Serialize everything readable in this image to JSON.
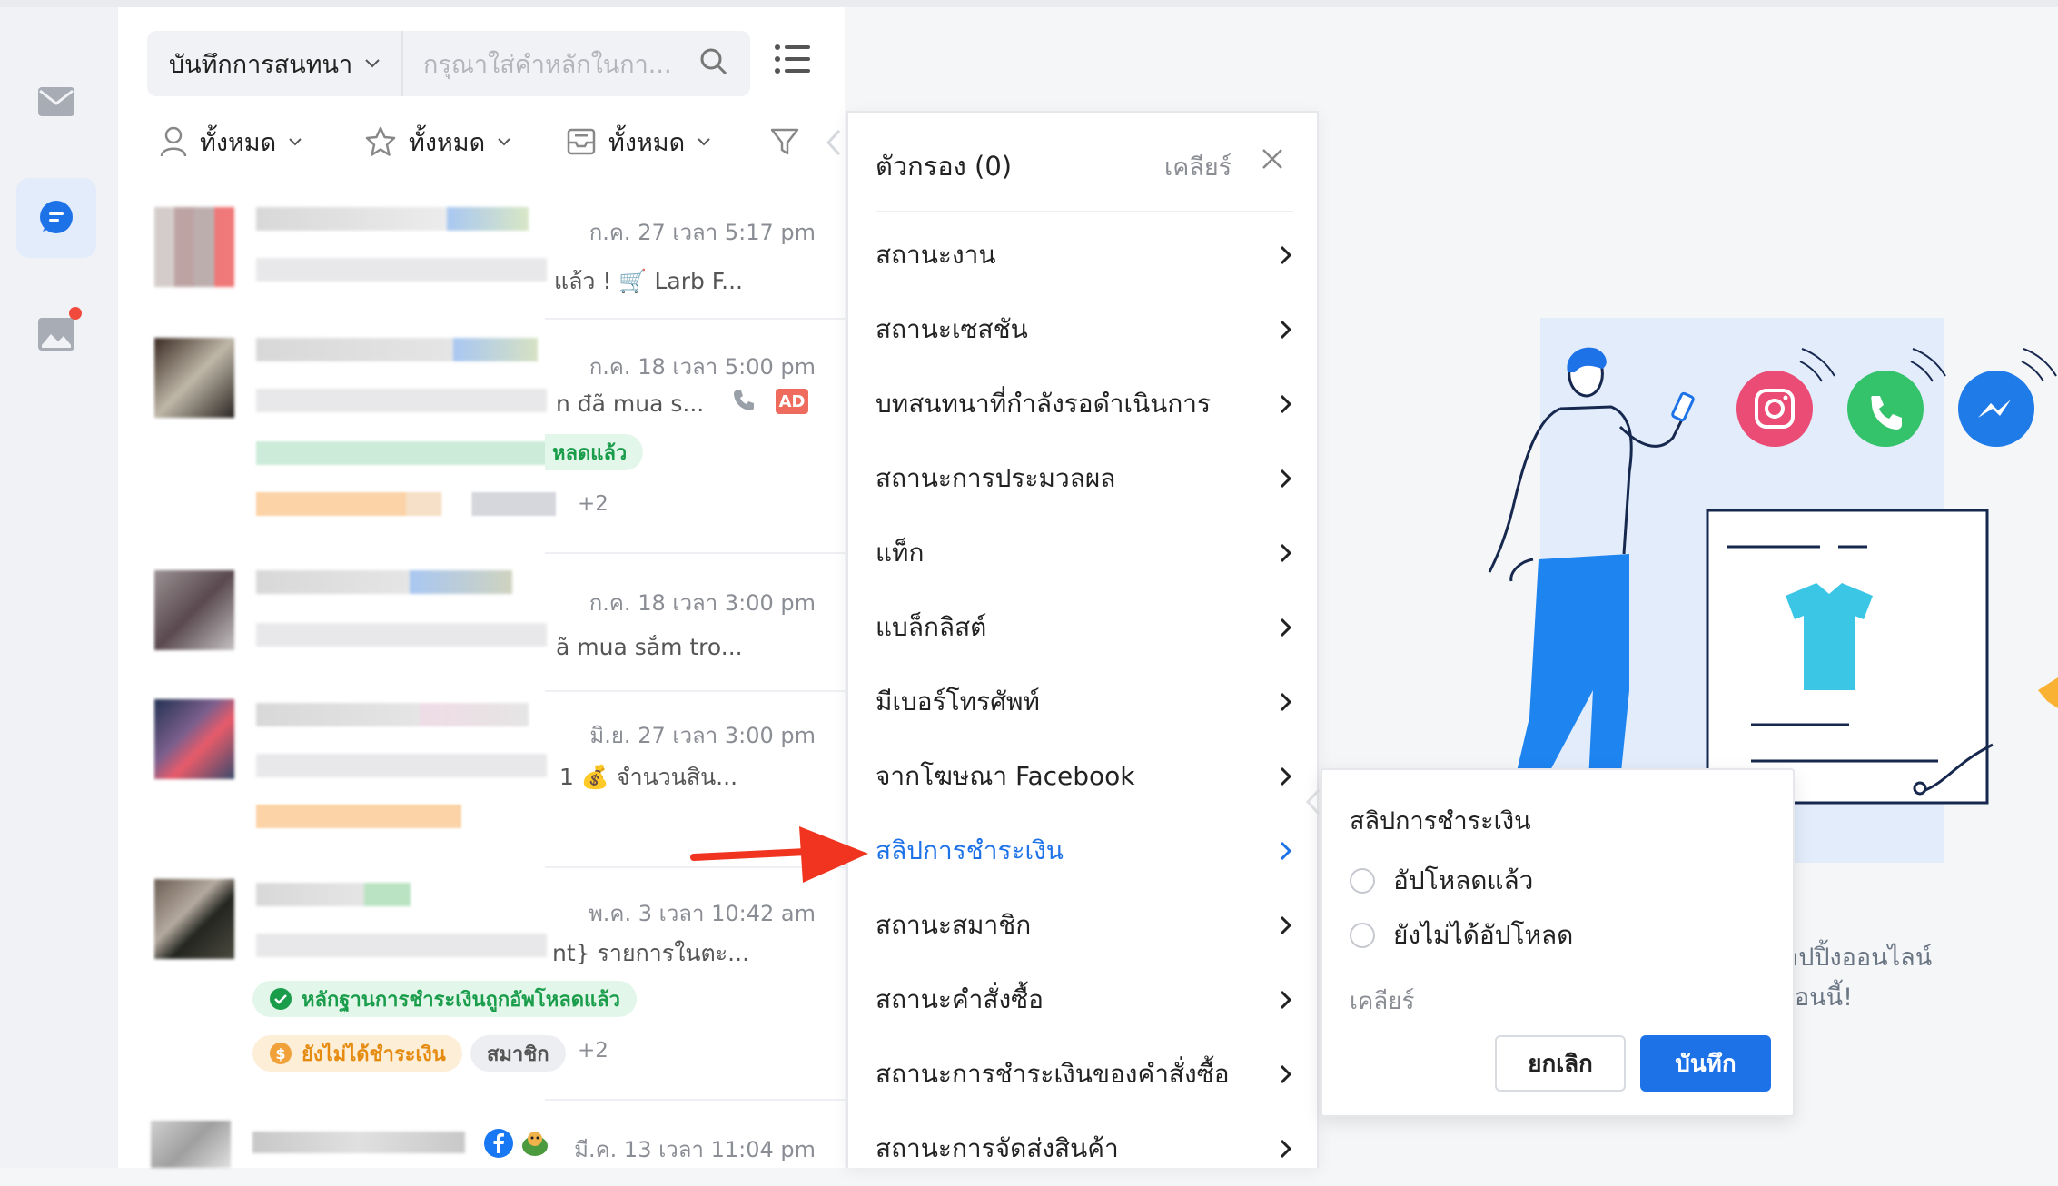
{
  "toolbar": {
    "log_select": "บันทึกการสนทนา",
    "search_placeholder": "กรุณาใส่คำหลักในกา..."
  },
  "filters": [
    {
      "label": "ทั้งหมด",
      "icon": "person-icon"
    },
    {
      "label": "ทั้งหมด",
      "icon": "star-icon"
    },
    {
      "label": "ทั้งหมด",
      "icon": "inbox-icon"
    }
  ],
  "conversations": [
    {
      "time": "ก.ค. 27 เวลา 5:17 pm",
      "snippet": "แล้ว ! 🛒 Larb F..."
    },
    {
      "time": "ก.ค. 18 เวลา 5:00 pm",
      "snippet": "n đã mua s...",
      "badge": "AD",
      "tag1": "หลดแล้ว",
      "more": "+2"
    },
    {
      "time": "ก.ค. 18 เวลา 3:00 pm",
      "snippet": "ã mua sắm tro..."
    },
    {
      "time": "มิ.ย. 27 เวลา 3:00 pm",
      "snippet": "1 💰 จำนวนสิน..."
    },
    {
      "time": "พ.ค. 3 เวลา 10:42 am",
      "snippet": "nt} รายการในตะ...",
      "tag_green": "หลักฐานการชำระเงินถูกอัพโหลดแล้ว",
      "tag_orange": "ยังไม่ได้ชำระเงิน",
      "tag_gray": "สมาชิก",
      "more": "+2"
    },
    {
      "time": "มี.ค. 13 เวลา 11:04 pm"
    }
  ],
  "filter_panel": {
    "title": "ตัวกรอง (0)",
    "clear": "เคลียร์",
    "items": [
      "สถานะงาน",
      "สถานะเซสชัน",
      "บทสนทนาที่กำลังรอดำเนินการ",
      "สถานะการประมวลผล",
      "แท็ก",
      "แบล็กลิสต์",
      "มีเบอร์โทรศัพท์",
      "จากโฆษณา Facebook",
      "สลิปการชำระเงิน",
      "สถานะสมาชิก",
      "สถานะคำสั่งซื้อ",
      "สถานะการชำระเงินของคำสั่งซื้อ",
      "สถานะการจัดส่งสินค้า"
    ],
    "active_index": 8
  },
  "sub_panel": {
    "title": "สลิปการชำระเงิน",
    "options": [
      "อัปโหลดแล้ว",
      "ยังไม่ได้อัปโหลด"
    ],
    "clear": "เคลียร์",
    "cancel": "ยกเลิก",
    "save": "บันทึก"
  },
  "illustration": {
    "line1": "อปปิ้งออนไลน์",
    "line2": "อนนี้!"
  },
  "colors": {
    "accent": "#1e72e8",
    "rail_active": "#e2ecfb",
    "notification": "#f04a3c",
    "instagram": "#ea4c75",
    "whatsapp": "#34c26b",
    "messenger": "#1e7be8"
  }
}
